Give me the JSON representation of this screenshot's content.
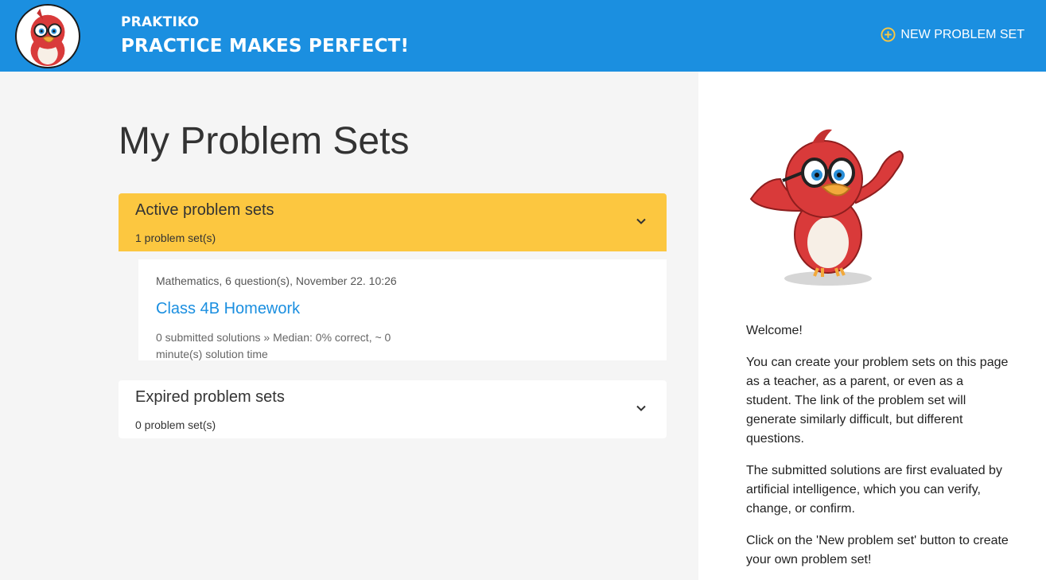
{
  "header": {
    "brand": "PRAKTIKO",
    "tagline": "PRACTICE MAKES PERFECT!",
    "new_button_label": "NEW PROBLEM SET",
    "accent_color": "#1b8fe0"
  },
  "main": {
    "title": "My Problem Sets",
    "active_section": {
      "title": "Active problem sets",
      "count": "1 problem set(s)",
      "color": "#fcc740",
      "items": [
        {
          "meta": "Mathematics, 6 question(s), November 22. 10:26",
          "title": "Class 4B Homework",
          "stats": "0 submitted solutions » Median: 0% correct, ~ 0 minute(s) solution time"
        }
      ]
    },
    "expired_section": {
      "title": "Expired problem sets",
      "count": "0 problem set(s)"
    }
  },
  "sidebar": {
    "welcome": "Welcome!",
    "paragraph1": "You can create your problem sets on this page as a teacher, as a parent, or even as a student. The link of the problem set will generate similarly difficult, but different questions.",
    "paragraph2": "The submitted solutions are first evaluated by artificial intelligence, which you can verify, change, or confirm.",
    "paragraph3": "Click on the 'New problem set' button to create your own problem set!"
  },
  "icons": {
    "logo": "bird-mascot-icon",
    "new": "plus-circle-icon",
    "expand": "chevron-down-icon"
  }
}
